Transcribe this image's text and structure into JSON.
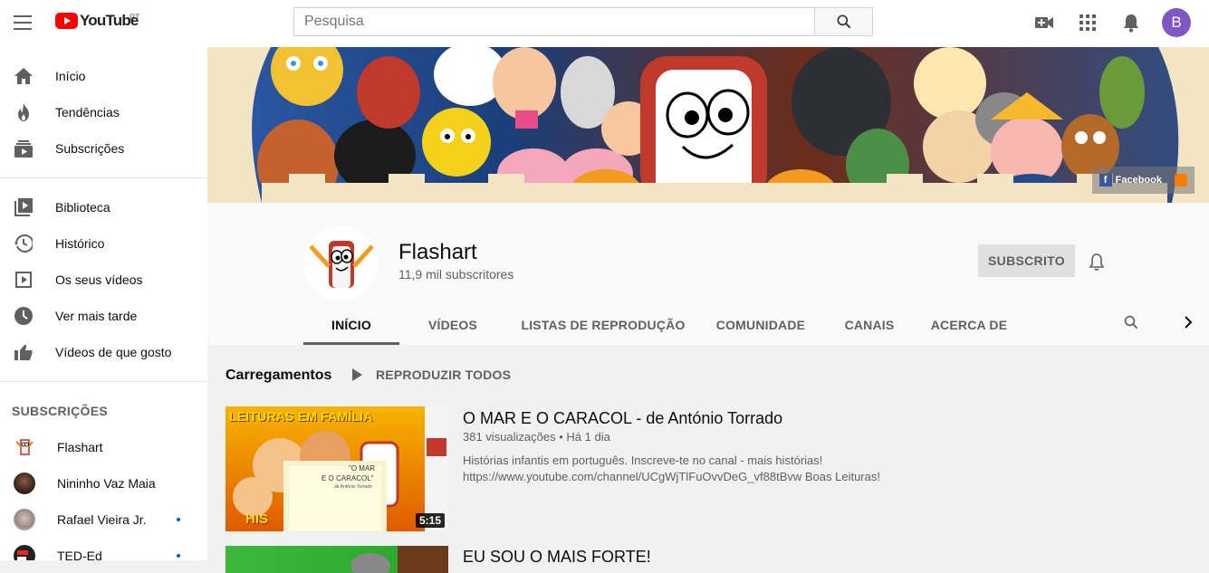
{
  "header": {
    "logo_text": "YouTube",
    "region": "PT",
    "search_placeholder": "Pesquisa",
    "avatar_letter": "B"
  },
  "sidebar": {
    "main": [
      {
        "label": "Início",
        "icon": "home-icon"
      },
      {
        "label": "Tendências",
        "icon": "trending-icon"
      },
      {
        "label": "Subscrições",
        "icon": "subscriptions-icon"
      }
    ],
    "library": [
      {
        "label": "Biblioteca",
        "icon": "library-icon"
      },
      {
        "label": "Histórico",
        "icon": "history-icon"
      },
      {
        "label": "Os seus vídeos",
        "icon": "your-videos-icon"
      },
      {
        "label": "Ver mais tarde",
        "icon": "watch-later-icon"
      },
      {
        "label": "Vídeos de que gosto",
        "icon": "liked-videos-icon"
      }
    ],
    "subscriptions_heading": "SUBSCRIÇÕES",
    "subscriptions": [
      {
        "label": "Flashart",
        "new": false
      },
      {
        "label": "Nininho Vaz Maia",
        "new": false
      },
      {
        "label": "Rafael Vieira Jr.",
        "new": true
      },
      {
        "label": "TED-Ed",
        "new": true
      }
    ]
  },
  "banner": {
    "facebook_label": "Facebook"
  },
  "channel": {
    "name": "Flashart",
    "subscribers": "11,9 mil subscritores",
    "subscribed_label": "SUBSCRITO",
    "tabs": [
      "INÍCIO",
      "VÍDEOS",
      "LISTAS DE REPRODUÇÃO",
      "COMUNIDADE",
      "CANAIS",
      "ACERCA DE"
    ],
    "active_tab": "INÍCIO"
  },
  "uploads": {
    "section_title": "Carregamentos",
    "play_all": "REPRODUZIR TODOS",
    "videos": [
      {
        "title": "O MAR E O CARACOL - de António Torrado",
        "views": "381 visualizações",
        "age": "Há 1 dia",
        "description_1": "Histórias infantis em português. Inscreve-te no canal - mais histórias!",
        "description_2": "https://www.youtube.com/channel/UCgWjTlFuOvvDeG_vf88tBvw Boas Leituras!",
        "duration": "5:15",
        "thumb_text_top": "LEITURAS EM FAMÍLIA",
        "thumb_text_book_1": "\"O MAR",
        "thumb_text_book_2": "E O CARACOL\"",
        "thumb_text_book_3": "de António Torrado",
        "thumb_text_bottom": "HIS"
      },
      {
        "title": "EU SOU O MAIS FORTE!"
      }
    ]
  },
  "colors": {
    "brand_red": "#ff0000",
    "link_blue": "#065fd4",
    "avatar_purple": "#7e57c2"
  }
}
